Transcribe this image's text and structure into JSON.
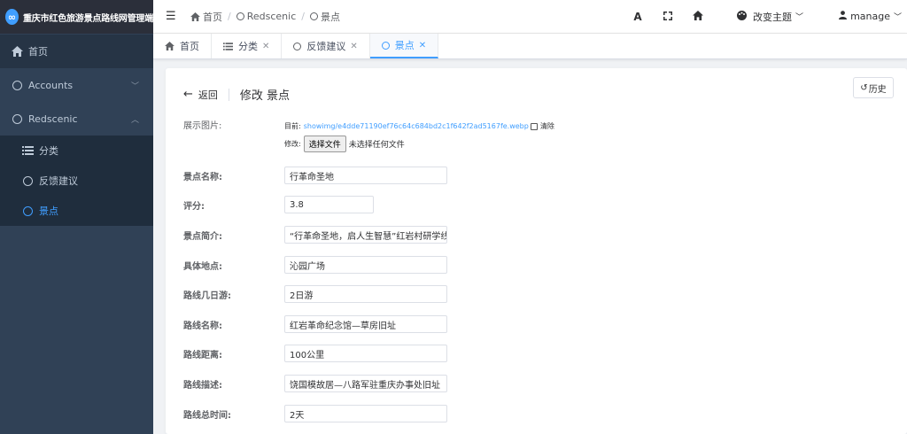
{
  "brand": {
    "logo": "∞",
    "title": "重庆市红色旅游景点路线网管理端"
  },
  "sidebar": {
    "home": "首页",
    "items": [
      {
        "label": "Accounts",
        "expanded": false
      },
      {
        "label": "Redscenic",
        "expanded": true
      }
    ],
    "submenu": [
      {
        "label": "分类",
        "icon": "list-icon"
      },
      {
        "label": "反馈建议",
        "icon": "circle-icon"
      },
      {
        "label": "景点",
        "icon": "circle-icon",
        "active": true
      }
    ]
  },
  "navbar": {
    "breadcrumb": [
      "首页",
      "Redscenic",
      "景点"
    ],
    "font_size_icon": "A",
    "theme_label": "改变主题",
    "user_label": "manage"
  },
  "tags": [
    {
      "label": "首页",
      "closable": false
    },
    {
      "label": "分类",
      "closable": true
    },
    {
      "label": "反馈建议",
      "closable": true
    },
    {
      "label": "景点",
      "closable": true,
      "active": true
    }
  ],
  "header": {
    "back_label": "返回",
    "title": "修改 景点",
    "history_label": "历史"
  },
  "image_field": {
    "label": "展示图片:",
    "current_prefix": "目前:",
    "current_link": "showimg/e4dde71190ef76c64c684bd2c1f642f2ad5167fe.webp",
    "clear_label": "清除",
    "change_prefix": "修改:",
    "choose_button": "选择文件",
    "no_file_text": "未选择任何文件"
  },
  "form": [
    {
      "label": "景点名称:",
      "value": "行革命圣地"
    },
    {
      "label": "评分:",
      "value": "3.8"
    },
    {
      "label": "景点简介:",
      "value": "“行革命圣地，启人生智慧”红岩村研学线路"
    },
    {
      "label": "具体地点:",
      "value": "沁园广场"
    },
    {
      "label": "路线几日游:",
      "value": "2日游"
    },
    {
      "label": "路线名称:",
      "value": "红岩革命纪念馆—草房旧址"
    },
    {
      "label": "路线距离:",
      "value": "100公里"
    },
    {
      "label": "路线描述:",
      "value": "饶国模故居—八路军驻重庆办事处旧址"
    },
    {
      "label": "路线总时间:",
      "value": "2天"
    }
  ],
  "colors": {
    "sidebar_bg": "#304156",
    "accent": "#409eff"
  }
}
